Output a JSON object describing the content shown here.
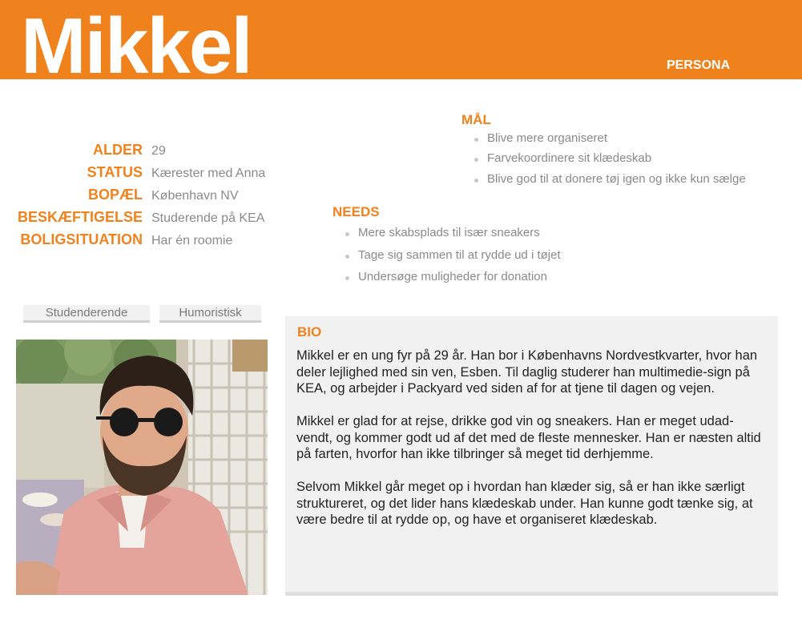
{
  "header": {
    "name": "Mikkel",
    "tag": "PERSONA"
  },
  "facts": [
    {
      "label": "ALDER",
      "value": "29"
    },
    {
      "label": "STATUS",
      "value": "Kærester med Anna"
    },
    {
      "label": "BOPÆL",
      "value": "København NV"
    },
    {
      "label": "BESKÆFTIGELSE",
      "value": "Studerende på KEA"
    },
    {
      "label": "BOLIGSITUATION",
      "value": "Har én roomie"
    }
  ],
  "goals": {
    "title": "MÅL",
    "items": [
      "Blive mere organiseret",
      "Farvekoordinere sit klædeskab",
      "Blive god til at donere tøj igen og ikke kun sælge"
    ]
  },
  "needs": {
    "title": "NEEDS",
    "items": [
      "Mere skabsplads til især sneakers",
      "Tage sig sammen til at rydde ud i tøjet",
      "Undersøge muligheder for donation"
    ]
  },
  "traits": [
    "Studenderende",
    "Humoristisk"
  ],
  "bio": {
    "title": "BIO",
    "paragraphs": [
      "Mikkel er en ung fyr på 29 år. Han bor i Københavns Nordvestkvarter, hvor han deler lejlighed med sin ven, Esben. Til daglig studerer han multimedie-sign på KEA, og arbejder i Packyard ved siden af for at tjene til dagen og vejen.",
      "Mikkel er glad for at rejse, drikke god vin og sneakers. Han er meget udad-vendt, og kommer godt ud af det med de fleste mennesker. Han er næsten altid på farten, hvorfor han ikke tilbringer så meget tid derhjemme.",
      "Selvom Mikkel går meget op i hvordan han klæder sig, så er han ikke særligt struktureret, og det lider hans klædeskab under. Han kunne godt tænke sig, at være bedre til at rydde op, og have et organiseret klædeskab."
    ]
  },
  "colors": {
    "accent": "#f0821e",
    "muted_text": "#8a8a8a",
    "panel_bg": "#f1f1f1"
  }
}
